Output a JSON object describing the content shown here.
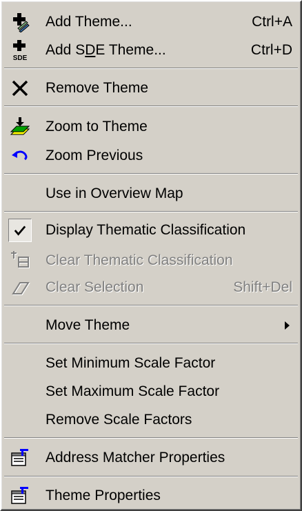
{
  "menu": {
    "items": {
      "add_theme": {
        "label": "Add Theme...",
        "shortcut": "Ctrl+A",
        "icon": "add-theme-icon"
      },
      "add_sde_theme": {
        "label_pre": "Add S",
        "label_u": "D",
        "label_post": "E Theme...",
        "shortcut": "Ctrl+D",
        "icon": "add-sde-theme-icon",
        "icon_text": "SDE"
      },
      "remove_theme": {
        "label": "Remove Theme",
        "icon": "remove-x-icon"
      },
      "zoom_to_theme": {
        "label": "Zoom to Theme",
        "icon": "zoom-to-theme-icon"
      },
      "zoom_previous": {
        "label": "Zoom Previous",
        "icon": "zoom-previous-arrow-icon"
      },
      "use_in_overview": {
        "label": "Use in Overview Map"
      },
      "display_thematic": {
        "label": "Display Thematic Classification",
        "checked": true,
        "icon": "checkmark-icon"
      },
      "clear_thematic": {
        "label": "Clear Thematic Classification",
        "disabled": true,
        "icon": "clear-classification-icon"
      },
      "clear_selection": {
        "label": "Clear Selection",
        "shortcut": "Shift+Del",
        "disabled": true,
        "icon": "eraser-icon"
      },
      "move_theme": {
        "label": "Move Theme",
        "submenu": true,
        "icon": "submenu-arrow-icon"
      },
      "set_min_scale": {
        "label": "Set Minimum Scale Factor"
      },
      "set_max_scale": {
        "label": "Set Maximum Scale Factor"
      },
      "remove_scale": {
        "label": "Remove Scale Factors"
      },
      "address_matcher": {
        "label": "Address Matcher Properties",
        "icon": "properties-icon"
      },
      "theme_properties": {
        "label": "Theme Properties",
        "icon": "properties-icon"
      }
    },
    "colors": {
      "menu_bg": "#d4d0c8",
      "disabled_text": "#808080",
      "highlight_white": "#ffffff",
      "icon_blue": "#0000ff",
      "icon_yellow": "#ffff00",
      "icon_green": "#00a000"
    }
  }
}
